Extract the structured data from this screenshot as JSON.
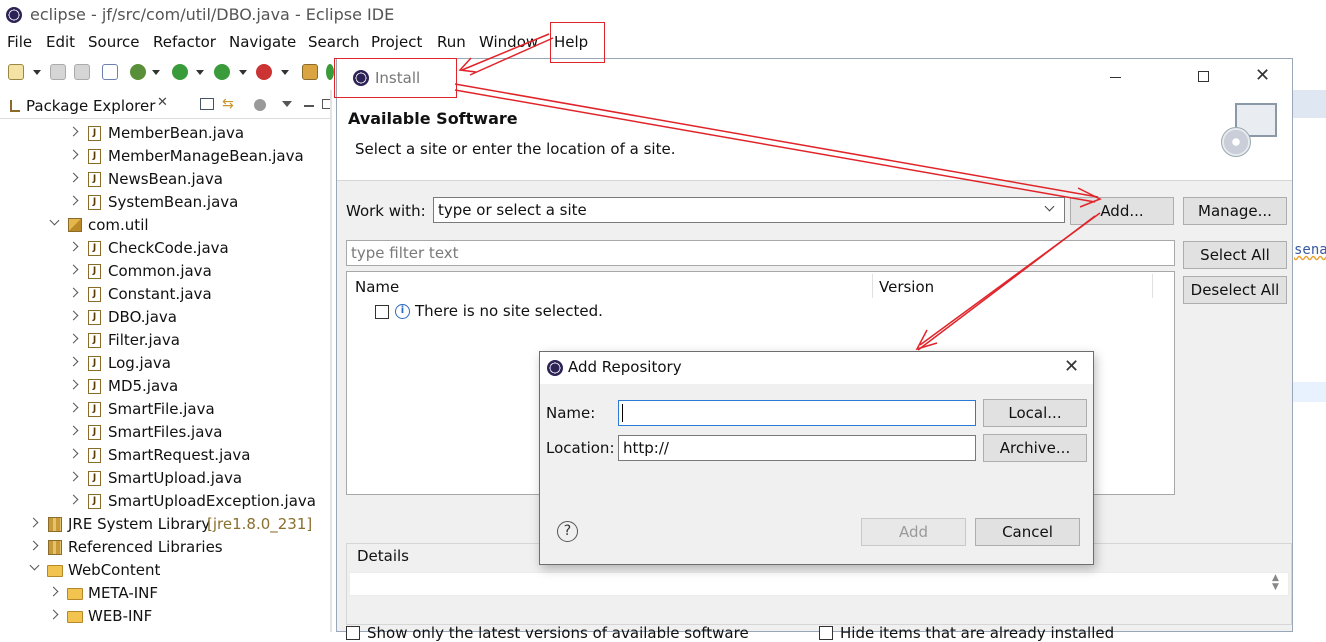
{
  "window": {
    "title": "eclipse - jf/src/com/util/DBO.java - Eclipse IDE"
  },
  "menubar": {
    "items": [
      "File",
      "Edit",
      "Source",
      "Refactor",
      "Navigate",
      "Search",
      "Project",
      "Run",
      "Window",
      "Help"
    ]
  },
  "package_explorer": {
    "title": "Package Explorer",
    "items": [
      {
        "label": "MemberBean.java",
        "kind": "java"
      },
      {
        "label": "MemberManageBean.java",
        "kind": "java"
      },
      {
        "label": "NewsBean.java",
        "kind": "java"
      },
      {
        "label": "SystemBean.java",
        "kind": "java"
      },
      {
        "label": "com.util",
        "kind": "package"
      },
      {
        "label": "CheckCode.java",
        "kind": "java"
      },
      {
        "label": "Common.java",
        "kind": "java"
      },
      {
        "label": "Constant.java",
        "kind": "java"
      },
      {
        "label": "DBO.java",
        "kind": "java"
      },
      {
        "label": "Filter.java",
        "kind": "java"
      },
      {
        "label": "Log.java",
        "kind": "java"
      },
      {
        "label": "MD5.java",
        "kind": "java"
      },
      {
        "label": "SmartFile.java",
        "kind": "java"
      },
      {
        "label": "SmartFiles.java",
        "kind": "java"
      },
      {
        "label": "SmartRequest.java",
        "kind": "java"
      },
      {
        "label": "SmartUpload.java",
        "kind": "java"
      },
      {
        "label": "SmartUploadException.java",
        "kind": "java"
      },
      {
        "label": "JRE System Library",
        "suffix": "[jre1.8.0_231]",
        "kind": "library"
      },
      {
        "label": "Referenced Libraries",
        "kind": "library"
      },
      {
        "label": "WebContent",
        "kind": "folder"
      },
      {
        "label": "META-INF",
        "kind": "folder"
      },
      {
        "label": "WEB-INF",
        "kind": "folder"
      }
    ]
  },
  "editor_fragment": "sena",
  "install": {
    "title": "Install",
    "heading": "Available Software",
    "subheading": "Select a site or enter the location of a site.",
    "work_with_label": "Work with:",
    "work_with_value": "type or select a site",
    "add_label": "Add...",
    "manage_label": "Manage...",
    "filter_placeholder": "type filter text",
    "select_all_label": "Select All",
    "deselect_all_label": "Deselect All",
    "columns": {
      "name": "Name",
      "version": "Version"
    },
    "empty_message": "There is no site selected.",
    "details_label": "Details",
    "bottom_left": "Show only the latest versions of available software",
    "bottom_right": "Hide items that are already installed"
  },
  "add_repository": {
    "title": "Add Repository",
    "name_label": "Name:",
    "name_value": "",
    "location_label": "Location:",
    "location_value": "http://",
    "local_label": "Local...",
    "archive_label": "Archive...",
    "add_label": "Add",
    "cancel_label": "Cancel"
  },
  "colors": {
    "annotation": "#e0242a",
    "selection": "#cce8ff",
    "dialog_bg": "#f0f0f0"
  }
}
